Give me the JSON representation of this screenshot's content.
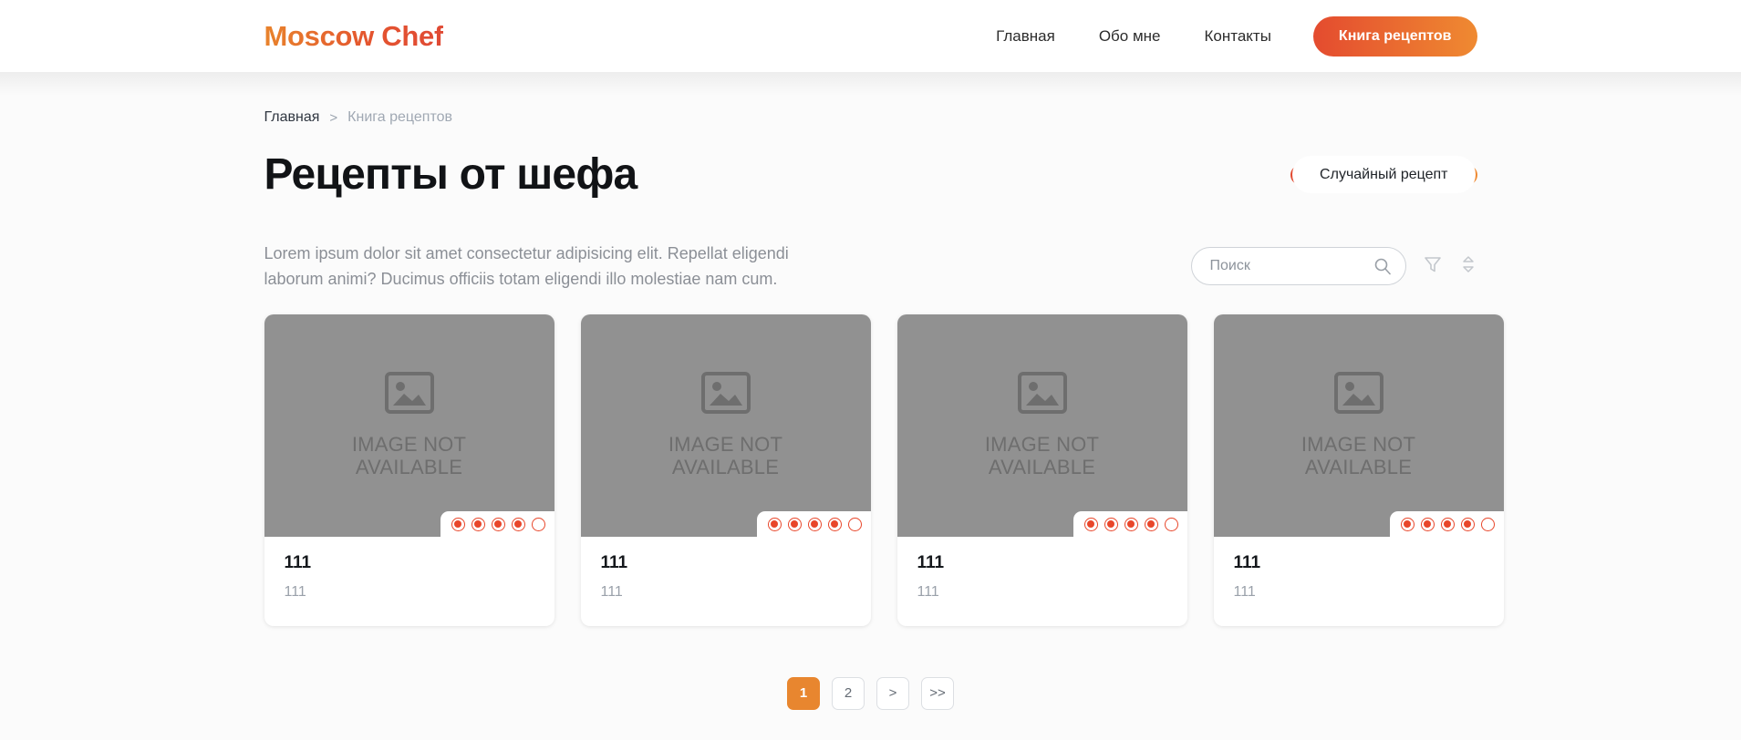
{
  "header": {
    "logo": "Moscow Chef",
    "nav": [
      {
        "label": "Главная"
      },
      {
        "label": "Обо мне"
      },
      {
        "label": "Контакты"
      }
    ],
    "cta_label": "Книга рецептов"
  },
  "breadcrumb": {
    "home": "Главная",
    "separator": ">",
    "current": "Книга рецептов"
  },
  "main": {
    "title": "Рецепты от шефа",
    "random_button": "Случайный рецепт",
    "description": "Lorem ipsum dolor sit amet consectetur adipisicing elit. Repellat eligendi laborum animi? Ducimus officiis totam eligendi illo molestiae nam cum."
  },
  "search": {
    "value": "",
    "placeholder": "Поиск",
    "search_icon": "search-icon",
    "filter_icon": "filter-funnel-icon",
    "sort_icon": "sort-icon"
  },
  "cards": [
    {
      "placeholder_text_line1": "IMAGE NOT",
      "placeholder_text_line2": "AVAILABLE",
      "title": "111",
      "subtitle": "111",
      "rating_filled": 4,
      "rating_total": 5
    },
    {
      "placeholder_text_line1": "IMAGE NOT",
      "placeholder_text_line2": "AVAILABLE",
      "title": "111",
      "subtitle": "111",
      "rating_filled": 4,
      "rating_total": 5
    },
    {
      "placeholder_text_line1": "IMAGE NOT",
      "placeholder_text_line2": "AVAILABLE",
      "title": "111",
      "subtitle": "111",
      "rating_filled": 4,
      "rating_total": 5
    },
    {
      "placeholder_text_line1": "IMAGE NOT",
      "placeholder_text_line2": "AVAILABLE",
      "title": "111",
      "subtitle": "111",
      "rating_filled": 4,
      "rating_total": 5
    }
  ],
  "pagination": {
    "items": [
      {
        "label": "1",
        "active": true
      },
      {
        "label": "2",
        "active": false
      },
      {
        "label": ">",
        "active": false
      },
      {
        "label": ">>",
        "active": false
      }
    ]
  },
  "colors": {
    "accent_orange": "#e8862f",
    "accent_red": "#e4482f",
    "placeholder_gray": "#919191",
    "page_bg": "#fbfbfb",
    "muted_text": "#8b8f96"
  }
}
